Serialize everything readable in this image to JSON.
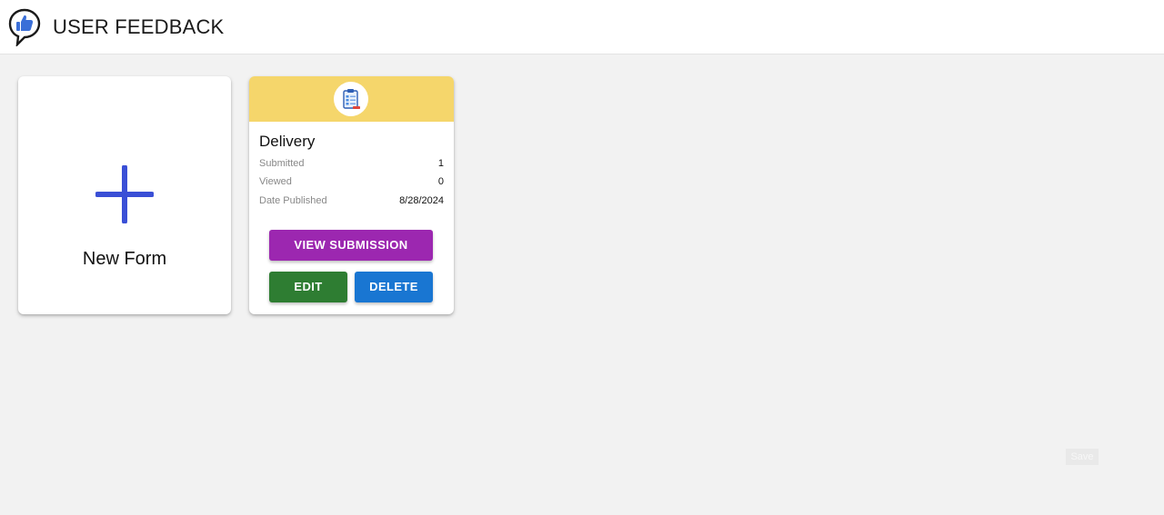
{
  "header": {
    "title": "USER FEEDBACK",
    "logo_icon": "thumbs-up-chat-bubble-icon"
  },
  "new_form_card": {
    "label": "New Form",
    "icon": "plus-icon",
    "icon_color": "#3a4fd6"
  },
  "forms": [
    {
      "title": "Delivery",
      "header_color": "#f5d66b",
      "icon": "clipboard-form-icon",
      "stats": [
        {
          "label": "Submitted",
          "value": "1"
        },
        {
          "label": "Viewed",
          "value": "0"
        },
        {
          "label": "Date Published",
          "value": "8/28/2024"
        }
      ],
      "buttons": {
        "view": "VIEW SUBMISSION",
        "edit": "EDIT",
        "delete": "DELETE"
      }
    }
  ],
  "colors": {
    "view_button": "#9c27b0",
    "edit_button": "#2e7d32",
    "delete_button": "#1976d2"
  },
  "footer": {
    "save_label": "Save"
  }
}
